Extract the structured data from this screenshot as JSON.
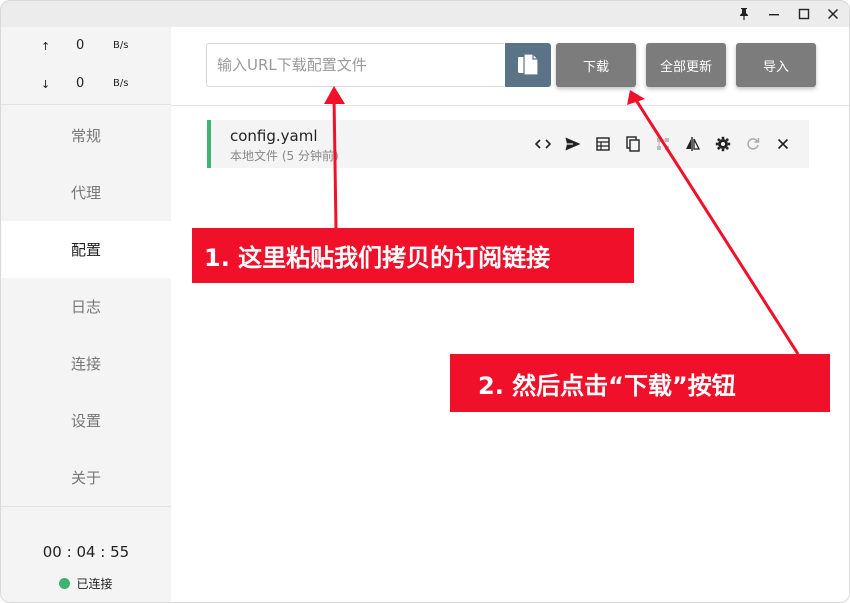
{
  "titlebar": {
    "pin_icon": "pin-icon",
    "minimize_icon": "minimize-icon",
    "maximize_icon": "maximize-icon",
    "close_icon": "close-icon"
  },
  "sidebar": {
    "upload": {
      "arrow": "↑",
      "value": "0",
      "unit": "B/s"
    },
    "download": {
      "arrow": "↓",
      "value": "0",
      "unit": "B/s"
    },
    "nav": [
      {
        "label": "常规"
      },
      {
        "label": "代理"
      },
      {
        "label": "配置"
      },
      {
        "label": "日志"
      },
      {
        "label": "连接"
      },
      {
        "label": "设置"
      },
      {
        "label": "关于"
      }
    ],
    "active_index": 2,
    "timer": "00 : 04 : 55",
    "status": "已连接",
    "status_color": "#3cb371"
  },
  "toolbar": {
    "url_placeholder": "输入URL下载配置文件",
    "download_label": "下载",
    "update_all_label": "全部更新",
    "import_label": "导入",
    "paste_color": "#5b7386",
    "button_color": "#7c7c7c"
  },
  "profile": {
    "name": "config.yaml",
    "subtitle": "本地文件 (5 分钟前)",
    "accent": "#3cb371",
    "actions": [
      "code-icon",
      "send-icon",
      "table-icon",
      "copy-icon",
      "link-icon",
      "compare-icon",
      "gear-icon",
      "refresh-icon",
      "close-icon"
    ]
  },
  "annotations": {
    "step1": "1. 这里粘贴我们拷贝的订阅链接",
    "step2": "2. 然后点击“下载”按钮",
    "color": "#f0102a"
  }
}
